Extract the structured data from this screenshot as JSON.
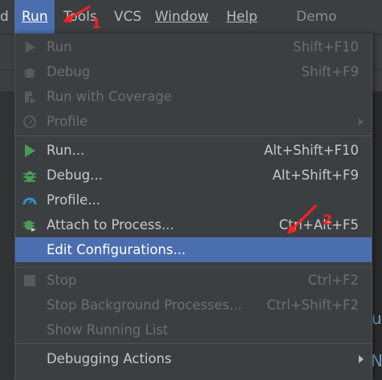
{
  "menubar": {
    "items": [
      "d",
      "Run",
      "Tools",
      "VCS",
      "Window",
      "Help"
    ],
    "project_name": "Demo"
  },
  "run_menu": {
    "items": [
      {
        "label": "Run",
        "shortcut": "Shift+F10",
        "enabled": false,
        "icon": "run-icon"
      },
      {
        "label": "Debug",
        "shortcut": "Shift+F9",
        "enabled": false,
        "icon": "debug-icon"
      },
      {
        "label": "Run with Coverage",
        "shortcut": "",
        "enabled": false,
        "icon": "coverage-icon"
      },
      {
        "label": "Profile",
        "shortcut": "",
        "enabled": false,
        "icon": "profile-icon",
        "submenu": true
      },
      {
        "label": "Run...",
        "shortcut": "Alt+Shift+F10",
        "enabled": true,
        "icon": "run-icon"
      },
      {
        "label": "Debug...",
        "shortcut": "Alt+Shift+F9",
        "enabled": true,
        "icon": "debug-icon"
      },
      {
        "label": "Profile...",
        "shortcut": "",
        "enabled": true,
        "icon": "profile-icon"
      },
      {
        "label": "Attach to Process...",
        "shortcut": "Ctrl+Alt+F5",
        "enabled": true,
        "icon": "attach-icon"
      },
      {
        "label": "Edit Configurations...",
        "shortcut": "",
        "enabled": true,
        "selected": true
      },
      {
        "label": "Stop",
        "shortcut": "Ctrl+F2",
        "enabled": false,
        "icon": "stop-icon"
      },
      {
        "label": "Stop Background Processes...",
        "shortcut": "Ctrl+Shift+F2",
        "enabled": false
      },
      {
        "label": "Show Running List",
        "shortcut": "",
        "enabled": false
      },
      {
        "label": "Debugging Actions",
        "shortcut": "",
        "enabled": true,
        "submenu": true
      }
    ]
  },
  "annotations": {
    "step1": "1",
    "step2": "2"
  },
  "colors": {
    "accent": "#4b6eaf",
    "run_green": "#499c54",
    "annotation_red": "#ff2020"
  }
}
